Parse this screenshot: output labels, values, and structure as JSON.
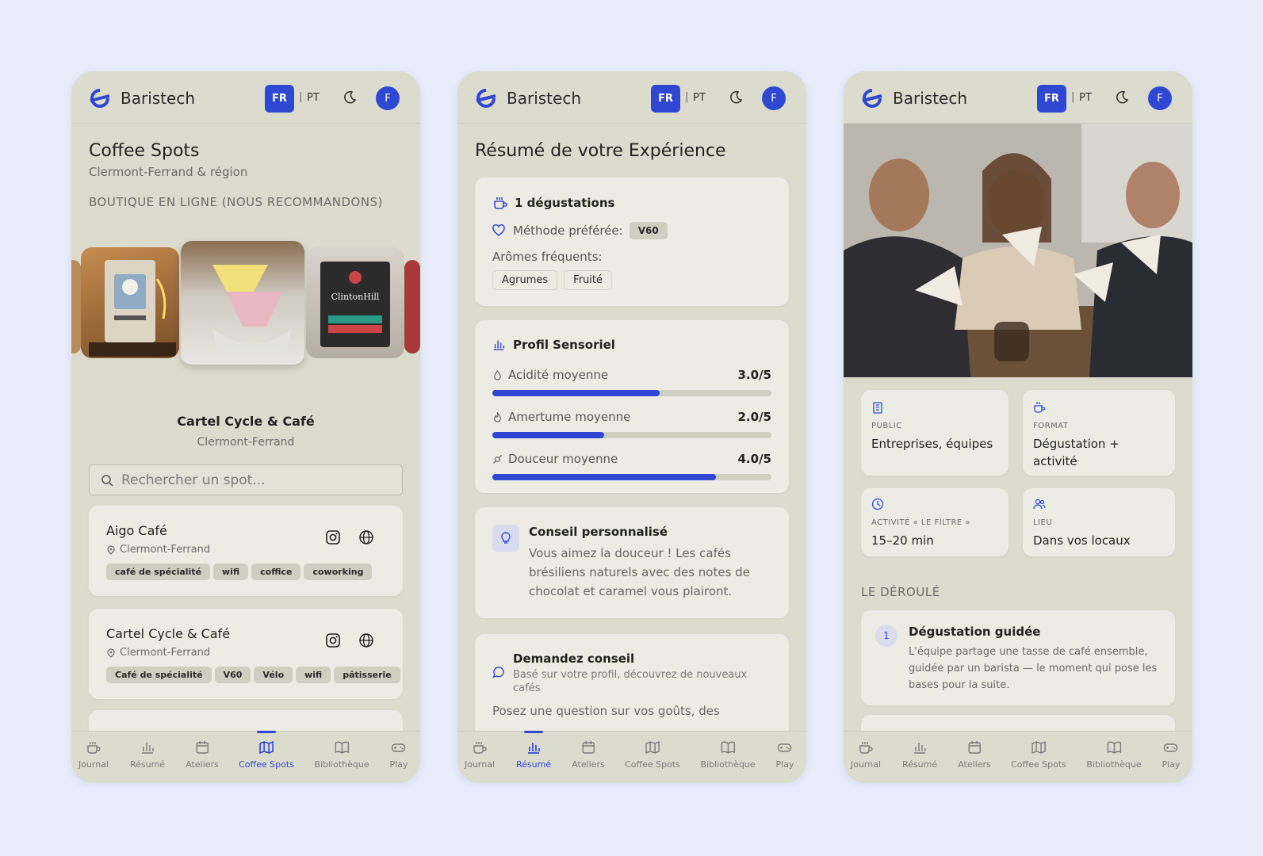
{
  "brand": "Baristech",
  "lang": {
    "fr": "FR",
    "sep": "|",
    "pt": "PT"
  },
  "avatar": "F",
  "nav": [
    "Journal",
    "Résumé",
    "Ateliers",
    "Coffee Spots",
    "Bibliothèque",
    "Play"
  ],
  "colors": {
    "accent": "#3047d4",
    "bg": "#e8ecfb",
    "panel": "#dcdcce",
    "card": "#ecece4"
  },
  "spots_screen": {
    "title": "Coffee Spots",
    "subtitle": "Clermont-Ferrand & région",
    "section": "BOUTIQUE EN LIGNE (NOUS RECOMMANDONS)",
    "featured_name": "Cartel Cycle & Café",
    "featured_city": "Clermont-Ferrand",
    "search_placeholder": "Rechercher un spot...",
    "spots": [
      {
        "name": "Aigo Café",
        "city": "Clermont-Ferrand",
        "tags": [
          "café de spécialité",
          "wifi",
          "coffice",
          "coworking"
        ]
      },
      {
        "name": "Cartel Cycle & Café",
        "city": "Clermont-Ferrand",
        "tags": [
          "Café de spécialité",
          "V60",
          "Vélo",
          "wifi",
          "pâtisserie"
        ]
      }
    ]
  },
  "summary_screen": {
    "title": "Résumé de votre Expérience",
    "tastings": "1 dégustations",
    "method_label": "Méthode préférée:",
    "method_value": "V60",
    "aromas_label": "Arômes fréquents:",
    "aromas": [
      "Agrumes",
      "Fruité"
    ],
    "profile_title": "Profil Sensoriel",
    "metrics": [
      {
        "label": "Acidité moyenne",
        "value": "3.0/5",
        "score": 3.0
      },
      {
        "label": "Amertume moyenne",
        "value": "2.0/5",
        "score": 2.0
      },
      {
        "label": "Douceur moyenne",
        "value": "4.0/5",
        "score": 4.0
      }
    ],
    "advice_title": "Conseil personnalisé",
    "advice_text": "Vous aimez la douceur ! Les cafés brésiliens naturels avec des notes de chocolat et caramel vous plairont.",
    "ask_title": "Demandez conseil",
    "ask_sub": "Basé sur votre profil, découvrez de nouveaux cafés",
    "ask_input": "Posez une question sur vos goûts, des"
  },
  "workshop_screen": {
    "info": [
      {
        "label": "PUBLIC",
        "value": "Entreprises, équipes",
        "icon": "building-icon"
      },
      {
        "label": "FORMAT",
        "value": "Dégustation + activité",
        "icon": "cup-icon"
      },
      {
        "label": "ACTIVITÉ « LE FILTRE »",
        "value": "15–20 min",
        "icon": "clock-icon"
      },
      {
        "label": "LIEU",
        "value": "Dans vos locaux",
        "icon": "users-icon"
      }
    ],
    "section": "LE DÉROULÉ",
    "steps": [
      {
        "num": "1",
        "title": "Dégustation guidée",
        "text": "L'équipe partage une tasse de café ensemble, guidée par un barista — le moment qui pose les bases pour la suite."
      }
    ]
  }
}
